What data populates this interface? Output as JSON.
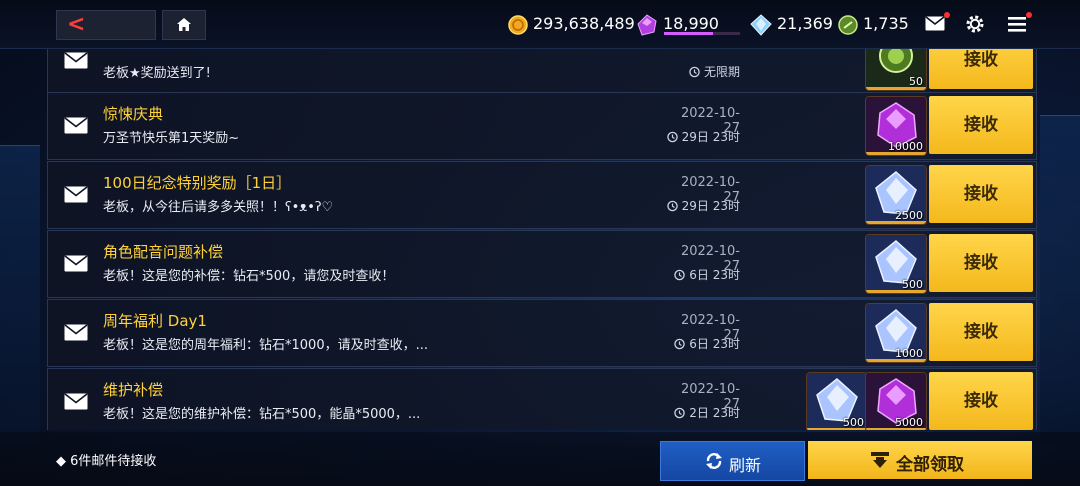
{
  "currencies": {
    "gold": "293,638,489",
    "amethyst": "18,990",
    "amethyst_progress": 0.65,
    "diamond": "21,369",
    "medal": "1,735"
  },
  "icons": {
    "back": "back-arrow-icon",
    "home": "home-icon",
    "mail": "mail-icon",
    "settings": "gear-icon",
    "menu": "menu-icon"
  },
  "colors": {
    "accent": "#ffd23a",
    "claim": "#f4b81c",
    "refresh": "#1f5fc4"
  },
  "mails": [
    {
      "title": "",
      "desc": "老板★奖励送到了!",
      "date": "",
      "remain": "无限期",
      "items": [
        {
          "type": "medal",
          "count": "50"
        }
      ],
      "claim": "接收"
    },
    {
      "title": "惊悚庆典",
      "desc": "万圣节快乐第1天奖励~",
      "date": "2022-10-27",
      "remain": "29日 23时",
      "items": [
        {
          "type": "amethyst",
          "count": "10000"
        }
      ],
      "claim": "接收"
    },
    {
      "title": "100日纪念特别奖励［1日］",
      "desc": "老板，从今往后请多多关照！！ʕ•ᴥ•ʔ♡",
      "date": "2022-10-27",
      "remain": "29日 23时",
      "items": [
        {
          "type": "diamond",
          "count": "2500"
        }
      ],
      "claim": "接收"
    },
    {
      "title": "角色配音问题补偿",
      "desc": "老板！这是您的补偿：钻石*500，请您及时查收！",
      "date": "2022-10-27",
      "remain": "6日 23时",
      "items": [
        {
          "type": "diamond",
          "count": "500"
        }
      ],
      "claim": "接收"
    },
    {
      "title": "周年福利  Day1",
      "desc": "老板！这是您的周年福利：钻石*1000，请及时查收，...",
      "date": "2022-10-27",
      "remain": "6日 23时",
      "items": [
        {
          "type": "diamond",
          "count": "1000"
        }
      ],
      "claim": "接收"
    },
    {
      "title": "维护补偿",
      "desc": "老板！这是您的维护补偿：钻石*500，能晶*5000，...",
      "date": "2022-10-27",
      "remain": "2日 23时",
      "items": [
        {
          "type": "diamond",
          "count": "500"
        },
        {
          "type": "amethyst",
          "count": "5000"
        }
      ],
      "claim": "接收"
    }
  ],
  "footer": {
    "pending": "◆ 6件邮件待接收",
    "refresh": "刷新",
    "claim_all": "全部领取"
  }
}
